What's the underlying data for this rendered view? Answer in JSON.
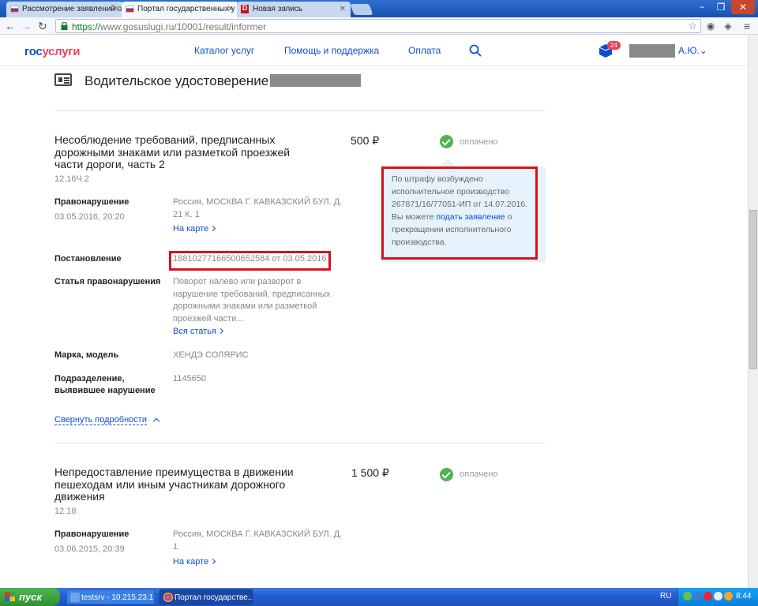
{
  "browser": {
    "tabs": [
      {
        "title": "Рассмотрение заявлений о",
        "favicon": "russia-flag-icon"
      },
      {
        "title": "Портал государственных у",
        "favicon": "russia-flag-icon"
      },
      {
        "title": "Новая запись",
        "favicon": "drive2-d-icon"
      }
    ],
    "url_scheme": "https://",
    "url_host": "www.gosuslugi.ru",
    "url_path": "/10001/result/informer"
  },
  "site": {
    "logo_part1": "гос",
    "logo_part2": "услуги",
    "nav": [
      "Каталог услуг",
      "Помощь и поддержка",
      "Оплата"
    ],
    "notifications_count": "24",
    "user_name": "А.Ю."
  },
  "license": {
    "title": "Водительское удостоверение:"
  },
  "violations": [
    {
      "title": "Несоблюдение требований, предписанных дорожными знаками или разметкой проезжей части дороги, часть 2",
      "code": "12.16Ч.2",
      "amount": "500 ₽",
      "status": "оплачено",
      "offense_label": "Правонарушение",
      "offense_datetime": "03.05.2016, 20:20",
      "address": "Россия, МОСКВА Г. КАВКАЗСКИЙ БУЛ. Д. 21 К. 1",
      "map_link": "На карте",
      "resolution_label": "Постановление",
      "resolution_value": "18810277166500652584 от 03.05.2016",
      "article_label": "Статья правонарушения",
      "article_text": "Поворот налево или разворот в нарушение требований, предписанных дорожными знаками или разметкой проезжей части...",
      "article_link": "Вся статья",
      "car_label": "Марка, модель",
      "car_value": "ХЕНДЭ СОЛЯРИС",
      "dept_label": "Подразделение, выявившее нарушение",
      "dept_value": "1145650",
      "collapse_link": "Свернуть подробности",
      "info": {
        "text_before": "По штрафу возбуждено исполнительное производство 267871/16/77051-ИП от 14.07.2016. Вы можете ",
        "link": "подать заявление",
        "text_after": " о прекращении исполнительного производства."
      }
    },
    {
      "title": "Непредоставление преимущества в движении пешеходам или иным участникам дорожного движения",
      "code": "12.18",
      "amount": "1 500 ₽",
      "status": "оплачено",
      "offense_label": "Правонарушение",
      "offense_datetime": "03.06.2015, 20:39",
      "address": "Россия, МОСКВА Г. КАВКАЗСКИЙ БУЛ. Д. 1",
      "map_link": "На карте"
    }
  ],
  "taskbar": {
    "start": "пуск",
    "items": [
      "testsrv - 10.215.23.1...",
      "Портал государстве..."
    ],
    "lang": "RU",
    "time": "8:44"
  }
}
